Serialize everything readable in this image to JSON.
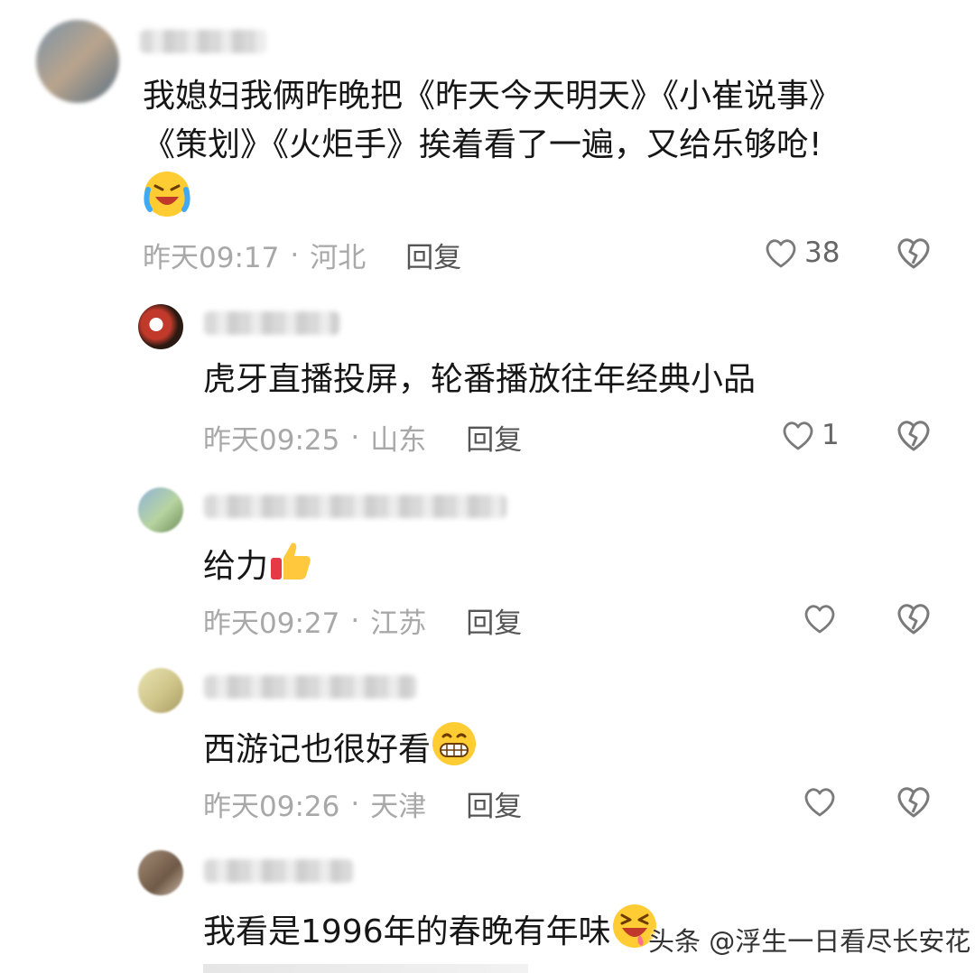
{
  "comments": [
    {
      "text_lines": [
        "我媳妇我俩昨晚把《昨天今天明天》《小崔说事》",
        "《策划》《火炬手》挨着看了一遍，又给乐够呛!"
      ],
      "emoji": "tears-of-joy-emoji",
      "time": "昨天09:17",
      "location": "河北",
      "reply": "回复",
      "likes": "38"
    },
    {
      "text": "虎牙直播投屏，轮番播放往年经典小品",
      "time": "昨天09:25",
      "location": "山东",
      "reply": "回复",
      "likes": "1"
    },
    {
      "text": "给力",
      "emoji": "thumbs-up-emoji",
      "time": "昨天09:27",
      "location": "江苏",
      "reply": "回复",
      "likes": ""
    },
    {
      "text": "西游记也很好看",
      "emoji": "grinning-emoji",
      "time": "昨天09:26",
      "location": "天津",
      "reply": "回复",
      "likes": ""
    },
    {
      "text": "我看是1996年的春晚有年味",
      "emoji": "laughing-emoji"
    }
  ],
  "watermark": "头条 @浮生一日看尽长安花",
  "colors": {
    "text": "#161616",
    "meta": "#a8a8a8",
    "icon": "#7a7a7a"
  }
}
